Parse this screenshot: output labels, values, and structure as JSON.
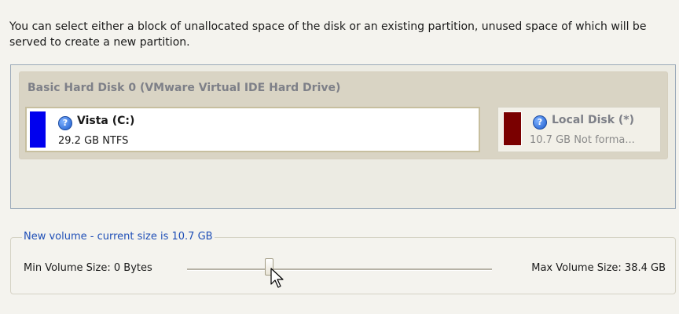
{
  "intro_text": "You can select either a block of unallocated space of the disk or an existing partition, unused space of which will be served to create a new partition.",
  "disk": {
    "title": "Basic Hard Disk 0 (VMware Virtual IDE Hard Drive)",
    "partitions": [
      {
        "name": "Vista (C:)",
        "info": "29.2 GB NTFS",
        "color": "#0000ee",
        "icon": "help-icon",
        "selected": true
      },
      {
        "name": "Local Disk (*)",
        "info": "10.7 GB Not forma...",
        "color": "#7a0000",
        "icon": "help-icon",
        "selected": false
      }
    ]
  },
  "volume": {
    "legend": "New volume - current size is 10.7 GB",
    "min_label": "Min Volume Size:  0 Bytes",
    "max_label": "Max Volume Size:  38.4 GB",
    "slider_position_fraction": 0.27
  },
  "colors": {
    "legend_text": "#1f4fb7",
    "disk_title": "#7e8088"
  }
}
